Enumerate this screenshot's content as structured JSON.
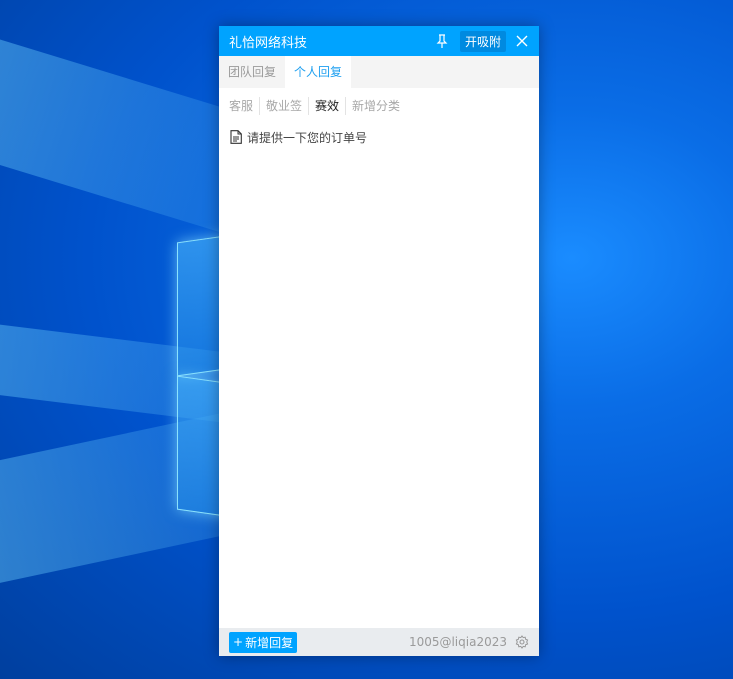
{
  "window": {
    "title": "礼恰网络科技",
    "absorb_label": "开吸附"
  },
  "tabs": [
    {
      "label": "团队回复",
      "active": false
    },
    {
      "label": "个人回复",
      "active": true
    }
  ],
  "categories": [
    {
      "label": "客服",
      "active": false
    },
    {
      "label": "敬业签",
      "active": false
    },
    {
      "label": "赛效",
      "active": true
    },
    {
      "label": "新增分类",
      "active": false
    }
  ],
  "replies": [
    {
      "text": "请提供一下您的订单号",
      "icon": "document-icon"
    }
  ],
  "footer": {
    "add_label": "新增回复",
    "account": "1005@liqia2023"
  },
  "colors": {
    "accent": "#00a3ff",
    "footer_bg": "#e9ecef"
  }
}
